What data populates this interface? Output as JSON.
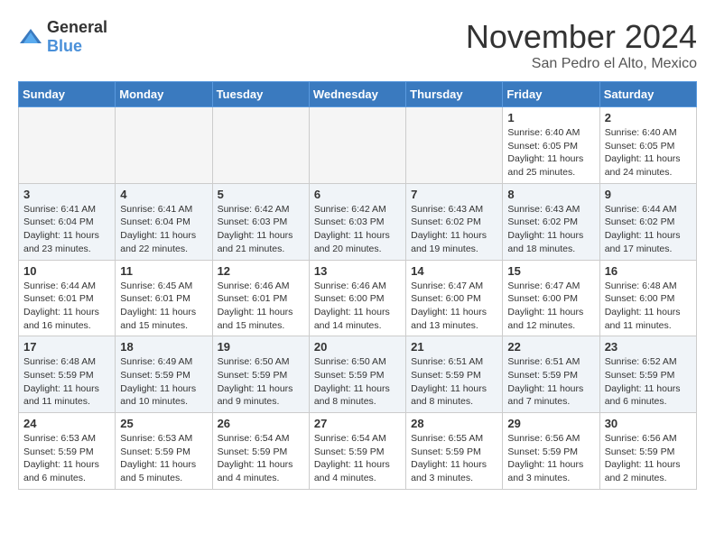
{
  "header": {
    "logo_general": "General",
    "logo_blue": "Blue",
    "month": "November 2024",
    "location": "San Pedro el Alto, Mexico"
  },
  "days_of_week": [
    "Sunday",
    "Monday",
    "Tuesday",
    "Wednesday",
    "Thursday",
    "Friday",
    "Saturday"
  ],
  "weeks": [
    {
      "row_alt": false,
      "days": [
        {
          "num": "",
          "info": ""
        },
        {
          "num": "",
          "info": ""
        },
        {
          "num": "",
          "info": ""
        },
        {
          "num": "",
          "info": ""
        },
        {
          "num": "",
          "info": ""
        },
        {
          "num": "1",
          "info": "Sunrise: 6:40 AM\nSunset: 6:05 PM\nDaylight: 11 hours\nand 25 minutes."
        },
        {
          "num": "2",
          "info": "Sunrise: 6:40 AM\nSunset: 6:05 PM\nDaylight: 11 hours\nand 24 minutes."
        }
      ]
    },
    {
      "row_alt": true,
      "days": [
        {
          "num": "3",
          "info": "Sunrise: 6:41 AM\nSunset: 6:04 PM\nDaylight: 11 hours\nand 23 minutes."
        },
        {
          "num": "4",
          "info": "Sunrise: 6:41 AM\nSunset: 6:04 PM\nDaylight: 11 hours\nand 22 minutes."
        },
        {
          "num": "5",
          "info": "Sunrise: 6:42 AM\nSunset: 6:03 PM\nDaylight: 11 hours\nand 21 minutes."
        },
        {
          "num": "6",
          "info": "Sunrise: 6:42 AM\nSunset: 6:03 PM\nDaylight: 11 hours\nand 20 minutes."
        },
        {
          "num": "7",
          "info": "Sunrise: 6:43 AM\nSunset: 6:02 PM\nDaylight: 11 hours\nand 19 minutes."
        },
        {
          "num": "8",
          "info": "Sunrise: 6:43 AM\nSunset: 6:02 PM\nDaylight: 11 hours\nand 18 minutes."
        },
        {
          "num": "9",
          "info": "Sunrise: 6:44 AM\nSunset: 6:02 PM\nDaylight: 11 hours\nand 17 minutes."
        }
      ]
    },
    {
      "row_alt": false,
      "days": [
        {
          "num": "10",
          "info": "Sunrise: 6:44 AM\nSunset: 6:01 PM\nDaylight: 11 hours\nand 16 minutes."
        },
        {
          "num": "11",
          "info": "Sunrise: 6:45 AM\nSunset: 6:01 PM\nDaylight: 11 hours\nand 15 minutes."
        },
        {
          "num": "12",
          "info": "Sunrise: 6:46 AM\nSunset: 6:01 PM\nDaylight: 11 hours\nand 15 minutes."
        },
        {
          "num": "13",
          "info": "Sunrise: 6:46 AM\nSunset: 6:00 PM\nDaylight: 11 hours\nand 14 minutes."
        },
        {
          "num": "14",
          "info": "Sunrise: 6:47 AM\nSunset: 6:00 PM\nDaylight: 11 hours\nand 13 minutes."
        },
        {
          "num": "15",
          "info": "Sunrise: 6:47 AM\nSunset: 6:00 PM\nDaylight: 11 hours\nand 12 minutes."
        },
        {
          "num": "16",
          "info": "Sunrise: 6:48 AM\nSunset: 6:00 PM\nDaylight: 11 hours\nand 11 minutes."
        }
      ]
    },
    {
      "row_alt": true,
      "days": [
        {
          "num": "17",
          "info": "Sunrise: 6:48 AM\nSunset: 5:59 PM\nDaylight: 11 hours\nand 11 minutes."
        },
        {
          "num": "18",
          "info": "Sunrise: 6:49 AM\nSunset: 5:59 PM\nDaylight: 11 hours\nand 10 minutes."
        },
        {
          "num": "19",
          "info": "Sunrise: 6:50 AM\nSunset: 5:59 PM\nDaylight: 11 hours\nand 9 minutes."
        },
        {
          "num": "20",
          "info": "Sunrise: 6:50 AM\nSunset: 5:59 PM\nDaylight: 11 hours\nand 8 minutes."
        },
        {
          "num": "21",
          "info": "Sunrise: 6:51 AM\nSunset: 5:59 PM\nDaylight: 11 hours\nand 8 minutes."
        },
        {
          "num": "22",
          "info": "Sunrise: 6:51 AM\nSunset: 5:59 PM\nDaylight: 11 hours\nand 7 minutes."
        },
        {
          "num": "23",
          "info": "Sunrise: 6:52 AM\nSunset: 5:59 PM\nDaylight: 11 hours\nand 6 minutes."
        }
      ]
    },
    {
      "row_alt": false,
      "days": [
        {
          "num": "24",
          "info": "Sunrise: 6:53 AM\nSunset: 5:59 PM\nDaylight: 11 hours\nand 6 minutes."
        },
        {
          "num": "25",
          "info": "Sunrise: 6:53 AM\nSunset: 5:59 PM\nDaylight: 11 hours\nand 5 minutes."
        },
        {
          "num": "26",
          "info": "Sunrise: 6:54 AM\nSunset: 5:59 PM\nDaylight: 11 hours\nand 4 minutes."
        },
        {
          "num": "27",
          "info": "Sunrise: 6:54 AM\nSunset: 5:59 PM\nDaylight: 11 hours\nand 4 minutes."
        },
        {
          "num": "28",
          "info": "Sunrise: 6:55 AM\nSunset: 5:59 PM\nDaylight: 11 hours\nand 3 minutes."
        },
        {
          "num": "29",
          "info": "Sunrise: 6:56 AM\nSunset: 5:59 PM\nDaylight: 11 hours\nand 3 minutes."
        },
        {
          "num": "30",
          "info": "Sunrise: 6:56 AM\nSunset: 5:59 PM\nDaylight: 11 hours\nand 2 minutes."
        }
      ]
    }
  ]
}
